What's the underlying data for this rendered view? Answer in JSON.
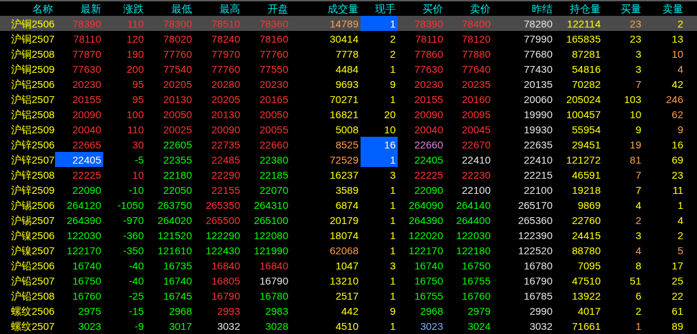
{
  "table": {
    "name_column": "名称",
    "columns": [
      "最新",
      "涨跌",
      "最低",
      "最高",
      "开盘",
      "成交量",
      "现手",
      "买价",
      "卖价",
      "昨结",
      "持仓量",
      "买量",
      "卖量"
    ],
    "rows": [
      {
        "name": "沪铜2506",
        "selected": true,
        "cells": [
          {
            "text": "78390",
            "color": "#ff3232"
          },
          {
            "text": "110",
            "color": "#ff3232"
          },
          {
            "text": "78300",
            "color": "#ff3232"
          },
          {
            "text": "78510",
            "color": "#ff3232"
          },
          {
            "text": "78360",
            "color": "#ff3232"
          },
          {
            "text": "14789",
            "color": "#ff9f4f"
          },
          {
            "text": "1",
            "color": "#ffffff",
            "highlighted": true
          },
          {
            "text": "78390",
            "color": "#ff3232"
          },
          {
            "text": "78400",
            "color": "#ff3232"
          },
          {
            "text": "78280",
            "color": "#e6e6e6"
          },
          {
            "text": "122114",
            "color": "#ffff00"
          },
          {
            "text": "23",
            "color": "#ff9f4f"
          },
          {
            "text": "2",
            "color": "#ffff00"
          }
        ]
      },
      {
        "name": "沪铜2507",
        "selected": false,
        "cells": [
          {
            "text": "78110",
            "color": "#ff3232"
          },
          {
            "text": "120",
            "color": "#ff3232"
          },
          {
            "text": "78020",
            "color": "#ff3232"
          },
          {
            "text": "78240",
            "color": "#ff3232"
          },
          {
            "text": "78160",
            "color": "#ff3232"
          },
          {
            "text": "30414",
            "color": "#ffff00"
          },
          {
            "text": "2",
            "color": "#ffff00"
          },
          {
            "text": "78110",
            "color": "#ff3232"
          },
          {
            "text": "78120",
            "color": "#ff3232"
          },
          {
            "text": "77990",
            "color": "#e6e6e6"
          },
          {
            "text": "165835",
            "color": "#ffff00"
          },
          {
            "text": "23",
            "color": "#ffff00"
          },
          {
            "text": "13",
            "color": "#ffff00"
          }
        ]
      },
      {
        "name": "沪铜2508",
        "selected": false,
        "cells": [
          {
            "text": "77870",
            "color": "#ff3232"
          },
          {
            "text": "190",
            "color": "#ff3232"
          },
          {
            "text": "77760",
            "color": "#ff3232"
          },
          {
            "text": "77970",
            "color": "#ff3232"
          },
          {
            "text": "77760",
            "color": "#ff3232"
          },
          {
            "text": "7778",
            "color": "#ffff00"
          },
          {
            "text": "2",
            "color": "#ffff00"
          },
          {
            "text": "77860",
            "color": "#ff3232"
          },
          {
            "text": "77880",
            "color": "#ff3232"
          },
          {
            "text": "77680",
            "color": "#e6e6e6"
          },
          {
            "text": "87281",
            "color": "#ffff00"
          },
          {
            "text": "3",
            "color": "#ffff00"
          },
          {
            "text": "10",
            "color": "#ff9f4f"
          }
        ]
      },
      {
        "name": "沪铜2509",
        "selected": false,
        "cells": [
          {
            "text": "77630",
            "color": "#ff3232"
          },
          {
            "text": "200",
            "color": "#ff3232"
          },
          {
            "text": "77540",
            "color": "#ff3232"
          },
          {
            "text": "77760",
            "color": "#ff3232"
          },
          {
            "text": "77550",
            "color": "#ff3232"
          },
          {
            "text": "4484",
            "color": "#ffff00"
          },
          {
            "text": "1",
            "color": "#ffff00"
          },
          {
            "text": "77630",
            "color": "#ff3232"
          },
          {
            "text": "77640",
            "color": "#ff3232"
          },
          {
            "text": "77430",
            "color": "#e6e6e6"
          },
          {
            "text": "54816",
            "color": "#ffff00"
          },
          {
            "text": "3",
            "color": "#ffff00"
          },
          {
            "text": "4",
            "color": "#ff9f4f"
          }
        ]
      },
      {
        "name": "沪铝2506",
        "selected": false,
        "cells": [
          {
            "text": "20230",
            "color": "#ff3232"
          },
          {
            "text": "95",
            "color": "#ff3232"
          },
          {
            "text": "20205",
            "color": "#ff3232"
          },
          {
            "text": "20280",
            "color": "#ff3232"
          },
          {
            "text": "20230",
            "color": "#ff3232"
          },
          {
            "text": "9693",
            "color": "#ffff00"
          },
          {
            "text": "9",
            "color": "#ffff00"
          },
          {
            "text": "20230",
            "color": "#ff3232"
          },
          {
            "text": "20235",
            "color": "#ff3232"
          },
          {
            "text": "20135",
            "color": "#e6e6e6"
          },
          {
            "text": "70282",
            "color": "#ffff00"
          },
          {
            "text": "7",
            "color": "#ff9f4f"
          },
          {
            "text": "42",
            "color": "#ffff00"
          }
        ]
      },
      {
        "name": "沪铝2507",
        "selected": false,
        "cells": [
          {
            "text": "20155",
            "color": "#ff3232"
          },
          {
            "text": "95",
            "color": "#ff3232"
          },
          {
            "text": "20130",
            "color": "#ff3232"
          },
          {
            "text": "20205",
            "color": "#ff3232"
          },
          {
            "text": "20165",
            "color": "#ff3232"
          },
          {
            "text": "70271",
            "color": "#ffff00"
          },
          {
            "text": "1",
            "color": "#ffff00"
          },
          {
            "text": "20155",
            "color": "#ff3232"
          },
          {
            "text": "20160",
            "color": "#ff3232"
          },
          {
            "text": "20060",
            "color": "#e6e6e6"
          },
          {
            "text": "205024",
            "color": "#ffff00"
          },
          {
            "text": "103",
            "color": "#ffff00"
          },
          {
            "text": "246",
            "color": "#ff9f4f"
          }
        ]
      },
      {
        "name": "沪铝2508",
        "selected": false,
        "cells": [
          {
            "text": "20090",
            "color": "#ff3232"
          },
          {
            "text": "100",
            "color": "#ff3232"
          },
          {
            "text": "20050",
            "color": "#ff3232"
          },
          {
            "text": "20130",
            "color": "#ff3232"
          },
          {
            "text": "20050",
            "color": "#ff3232"
          },
          {
            "text": "16821",
            "color": "#ffff00"
          },
          {
            "text": "20",
            "color": "#ffff00"
          },
          {
            "text": "20090",
            "color": "#ff3232"
          },
          {
            "text": "20095",
            "color": "#ff3232"
          },
          {
            "text": "19990",
            "color": "#e6e6e6"
          },
          {
            "text": "100457",
            "color": "#ffff00"
          },
          {
            "text": "10",
            "color": "#ffff00"
          },
          {
            "text": "62",
            "color": "#ff9f4f"
          }
        ]
      },
      {
        "name": "沪铝2509",
        "selected": false,
        "cells": [
          {
            "text": "20040",
            "color": "#ff3232"
          },
          {
            "text": "110",
            "color": "#ff3232"
          },
          {
            "text": "20025",
            "color": "#ff3232"
          },
          {
            "text": "20090",
            "color": "#ff3232"
          },
          {
            "text": "20055",
            "color": "#ff3232"
          },
          {
            "text": "5008",
            "color": "#ffff00"
          },
          {
            "text": "10",
            "color": "#ffff00"
          },
          {
            "text": "20040",
            "color": "#ff3232"
          },
          {
            "text": "20045",
            "color": "#ff3232"
          },
          {
            "text": "19930",
            "color": "#e6e6e6"
          },
          {
            "text": "55954",
            "color": "#ffff00"
          },
          {
            "text": "9",
            "color": "#ffff00"
          },
          {
            "text": "9",
            "color": "#ff9f4f"
          }
        ]
      },
      {
        "name": "沪锌2506",
        "selected": false,
        "cells": [
          {
            "text": "22665",
            "color": "#ff3232"
          },
          {
            "text": "30",
            "color": "#ff3232"
          },
          {
            "text": "22605",
            "color": "#00ff00"
          },
          {
            "text": "22735",
            "color": "#ff3232"
          },
          {
            "text": "22660",
            "color": "#ff3232"
          },
          {
            "text": "8525",
            "color": "#ff9f4f"
          },
          {
            "text": "16",
            "color": "#ffffff",
            "highlighted": true
          },
          {
            "text": "22660",
            "color": "#e080e0"
          },
          {
            "text": "22670",
            "color": "#ff3232"
          },
          {
            "text": "22635",
            "color": "#e6e6e6"
          },
          {
            "text": "29451",
            "color": "#ffff00"
          },
          {
            "text": "19",
            "color": "#ff9f4f"
          },
          {
            "text": "16",
            "color": "#ffff00"
          }
        ]
      },
      {
        "name": "沪锌2507",
        "selected": false,
        "cells": [
          {
            "text": "22405",
            "color": "#ffffff",
            "highlighted": true
          },
          {
            "text": "-5",
            "color": "#00ff00"
          },
          {
            "text": "22355",
            "color": "#00ff00"
          },
          {
            "text": "22485",
            "color": "#ff3232"
          },
          {
            "text": "22380",
            "color": "#00ff00"
          },
          {
            "text": "72529",
            "color": "#ff9f4f"
          },
          {
            "text": "1",
            "color": "#ffffff",
            "highlighted": true
          },
          {
            "text": "22405",
            "color": "#00ff00"
          },
          {
            "text": "22410",
            "color": "#e6e6e6"
          },
          {
            "text": "22410",
            "color": "#e6e6e6"
          },
          {
            "text": "121272",
            "color": "#ffff00"
          },
          {
            "text": "81",
            "color": "#ff9f4f"
          },
          {
            "text": "69",
            "color": "#ffff00"
          }
        ]
      },
      {
        "name": "沪锌2508",
        "selected": false,
        "cells": [
          {
            "text": "22225",
            "color": "#ff3232"
          },
          {
            "text": "10",
            "color": "#ff3232"
          },
          {
            "text": "22180",
            "color": "#00ff00"
          },
          {
            "text": "22290",
            "color": "#ff3232"
          },
          {
            "text": "22185",
            "color": "#00ff00"
          },
          {
            "text": "16237",
            "color": "#ffff00"
          },
          {
            "text": "3",
            "color": "#ffff00"
          },
          {
            "text": "22225",
            "color": "#ff3232"
          },
          {
            "text": "22230",
            "color": "#ff3232"
          },
          {
            "text": "22215",
            "color": "#e6e6e6"
          },
          {
            "text": "46591",
            "color": "#ffff00"
          },
          {
            "text": "7",
            "color": "#ff9f4f"
          },
          {
            "text": "23",
            "color": "#ffff00"
          }
        ]
      },
      {
        "name": "沪锌2509",
        "selected": false,
        "cells": [
          {
            "text": "22090",
            "color": "#00ff00"
          },
          {
            "text": "-10",
            "color": "#00ff00"
          },
          {
            "text": "22050",
            "color": "#00ff00"
          },
          {
            "text": "22155",
            "color": "#ff3232"
          },
          {
            "text": "22070",
            "color": "#00ff00"
          },
          {
            "text": "3589",
            "color": "#ffff00"
          },
          {
            "text": "1",
            "color": "#ffff00"
          },
          {
            "text": "22090",
            "color": "#00ff00"
          },
          {
            "text": "22100",
            "color": "#e6e6e6"
          },
          {
            "text": "22100",
            "color": "#e6e6e6"
          },
          {
            "text": "19218",
            "color": "#ffff00"
          },
          {
            "text": "7",
            "color": "#ffff00"
          },
          {
            "text": "11",
            "color": "#ffff00"
          }
        ]
      },
      {
        "name": "沪锡2506",
        "selected": false,
        "cells": [
          {
            "text": "264120",
            "color": "#00ff00"
          },
          {
            "text": "-1050",
            "color": "#00ff00"
          },
          {
            "text": "263750",
            "color": "#00ff00"
          },
          {
            "text": "265350",
            "color": "#ff3232"
          },
          {
            "text": "264310",
            "color": "#00ff00"
          },
          {
            "text": "6874",
            "color": "#ffff00"
          },
          {
            "text": "1",
            "color": "#ffff00"
          },
          {
            "text": "264090",
            "color": "#00ff00"
          },
          {
            "text": "264140",
            "color": "#00ff00"
          },
          {
            "text": "265170",
            "color": "#e6e6e6"
          },
          {
            "text": "9869",
            "color": "#ffff00"
          },
          {
            "text": "4",
            "color": "#ffff00"
          },
          {
            "text": "1",
            "color": "#ffff00"
          }
        ]
      },
      {
        "name": "沪锡2507",
        "selected": false,
        "cells": [
          {
            "text": "264390",
            "color": "#00ff00"
          },
          {
            "text": "-970",
            "color": "#00ff00"
          },
          {
            "text": "264020",
            "color": "#00ff00"
          },
          {
            "text": "265500",
            "color": "#ff3232"
          },
          {
            "text": "265100",
            "color": "#00ff00"
          },
          {
            "text": "20179",
            "color": "#ffff00"
          },
          {
            "text": "1",
            "color": "#ffff00"
          },
          {
            "text": "264390",
            "color": "#00ff00"
          },
          {
            "text": "264400",
            "color": "#00ff00"
          },
          {
            "text": "265360",
            "color": "#e6e6e6"
          },
          {
            "text": "22760",
            "color": "#ffff00"
          },
          {
            "text": "2",
            "color": "#ff9f4f"
          },
          {
            "text": "4",
            "color": "#ffff00"
          }
        ]
      },
      {
        "name": "沪镍2506",
        "selected": false,
        "cells": [
          {
            "text": "122030",
            "color": "#00ff00"
          },
          {
            "text": "-360",
            "color": "#00ff00"
          },
          {
            "text": "121520",
            "color": "#00ff00"
          },
          {
            "text": "122290",
            "color": "#00ff00"
          },
          {
            "text": "122080",
            "color": "#00ff00"
          },
          {
            "text": "18074",
            "color": "#ffff00"
          },
          {
            "text": "1",
            "color": "#ffff00"
          },
          {
            "text": "122020",
            "color": "#00ff00"
          },
          {
            "text": "122030",
            "color": "#00ff00"
          },
          {
            "text": "122390",
            "color": "#e6e6e6"
          },
          {
            "text": "24415",
            "color": "#ffff00"
          },
          {
            "text": "3",
            "color": "#ffff00"
          },
          {
            "text": "2",
            "color": "#ffff00"
          }
        ]
      },
      {
        "name": "沪镍2507",
        "selected": false,
        "cells": [
          {
            "text": "122170",
            "color": "#00ff00"
          },
          {
            "text": "-350",
            "color": "#00ff00"
          },
          {
            "text": "121610",
            "color": "#00ff00"
          },
          {
            "text": "122430",
            "color": "#00ff00"
          },
          {
            "text": "121990",
            "color": "#00ff00"
          },
          {
            "text": "62068",
            "color": "#ff9f4f"
          },
          {
            "text": "1",
            "color": "#ffff00"
          },
          {
            "text": "122170",
            "color": "#00ff00"
          },
          {
            "text": "122180",
            "color": "#00ff00"
          },
          {
            "text": "122520",
            "color": "#e6e6e6"
          },
          {
            "text": "88780",
            "color": "#ffff00"
          },
          {
            "text": "4",
            "color": "#ff9f4f"
          },
          {
            "text": "5",
            "color": "#ff9f4f"
          }
        ]
      },
      {
        "name": "沪铅2506",
        "selected": false,
        "cells": [
          {
            "text": "16740",
            "color": "#00ff00"
          },
          {
            "text": "-40",
            "color": "#00ff00"
          },
          {
            "text": "16735",
            "color": "#00ff00"
          },
          {
            "text": "16840",
            "color": "#ff3232"
          },
          {
            "text": "16840",
            "color": "#ff3232"
          },
          {
            "text": "1047",
            "color": "#ffff00"
          },
          {
            "text": "3",
            "color": "#ffff00"
          },
          {
            "text": "16740",
            "color": "#00ff00"
          },
          {
            "text": "16750",
            "color": "#00ff00"
          },
          {
            "text": "16780",
            "color": "#e6e6e6"
          },
          {
            "text": "7095",
            "color": "#ffff00"
          },
          {
            "text": "8",
            "color": "#ffff00"
          },
          {
            "text": "17",
            "color": "#ffff00"
          }
        ]
      },
      {
        "name": "沪铅2507",
        "selected": false,
        "cells": [
          {
            "text": "16750",
            "color": "#00ff00"
          },
          {
            "text": "-40",
            "color": "#00ff00"
          },
          {
            "text": "16740",
            "color": "#00ff00"
          },
          {
            "text": "16805",
            "color": "#ff3232"
          },
          {
            "text": "16790",
            "color": "#e6e6e6"
          },
          {
            "text": "13210",
            "color": "#ffff00"
          },
          {
            "text": "1",
            "color": "#ffff00"
          },
          {
            "text": "16750",
            "color": "#00ff00"
          },
          {
            "text": "16755",
            "color": "#00ff00"
          },
          {
            "text": "16790",
            "color": "#e6e6e6"
          },
          {
            "text": "47510",
            "color": "#ffff00"
          },
          {
            "text": "51",
            "color": "#ffff00"
          },
          {
            "text": "25",
            "color": "#ffff00"
          }
        ]
      },
      {
        "name": "沪铅2508",
        "selected": false,
        "cells": [
          {
            "text": "16760",
            "color": "#00ff00"
          },
          {
            "text": "-25",
            "color": "#00ff00"
          },
          {
            "text": "16745",
            "color": "#00ff00"
          },
          {
            "text": "16790",
            "color": "#ff3232"
          },
          {
            "text": "16780",
            "color": "#00ff00"
          },
          {
            "text": "2517",
            "color": "#ffff00"
          },
          {
            "text": "1",
            "color": "#ffff00"
          },
          {
            "text": "16755",
            "color": "#00ff00"
          },
          {
            "text": "16760",
            "color": "#00ff00"
          },
          {
            "text": "16785",
            "color": "#e6e6e6"
          },
          {
            "text": "13922",
            "color": "#ffff00"
          },
          {
            "text": "6",
            "color": "#ffff00"
          },
          {
            "text": "22",
            "color": "#ffff00"
          }
        ]
      },
      {
        "name": "螺纹2506",
        "selected": false,
        "cells": [
          {
            "text": "2975",
            "color": "#00ff00"
          },
          {
            "text": "-15",
            "color": "#00ff00"
          },
          {
            "text": "2968",
            "color": "#00ff00"
          },
          {
            "text": "2993",
            "color": "#ff3232"
          },
          {
            "text": "2983",
            "color": "#00ff00"
          },
          {
            "text": "442",
            "color": "#ffff00"
          },
          {
            "text": "9",
            "color": "#ffff00"
          },
          {
            "text": "2968",
            "color": "#00ff00"
          },
          {
            "text": "2979",
            "color": "#00ff00"
          },
          {
            "text": "2990",
            "color": "#e6e6e6"
          },
          {
            "text": "4017",
            "color": "#ffff00"
          },
          {
            "text": "2",
            "color": "#ffff00"
          },
          {
            "text": "61",
            "color": "#ffff00"
          }
        ]
      },
      {
        "name": "螺纹2507",
        "selected": false,
        "cells": [
          {
            "text": "3023",
            "color": "#00ff00"
          },
          {
            "text": "-9",
            "color": "#00ff00"
          },
          {
            "text": "3017",
            "color": "#00ff00"
          },
          {
            "text": "3032",
            "color": "#e6e6e6"
          },
          {
            "text": "3028",
            "color": "#00ff00"
          },
          {
            "text": "4510",
            "color": "#ffff00"
          },
          {
            "text": "1",
            "color": "#ffff00"
          },
          {
            "text": "3023",
            "color": "#80b0ff"
          },
          {
            "text": "3024",
            "color": "#00ff00"
          },
          {
            "text": "3032",
            "color": "#e6e6e6"
          },
          {
            "text": "71661",
            "color": "#ffff00"
          },
          {
            "text": "1",
            "color": "#ff9f4f"
          },
          {
            "text": "89",
            "color": "#ffff00"
          }
        ]
      }
    ]
  }
}
